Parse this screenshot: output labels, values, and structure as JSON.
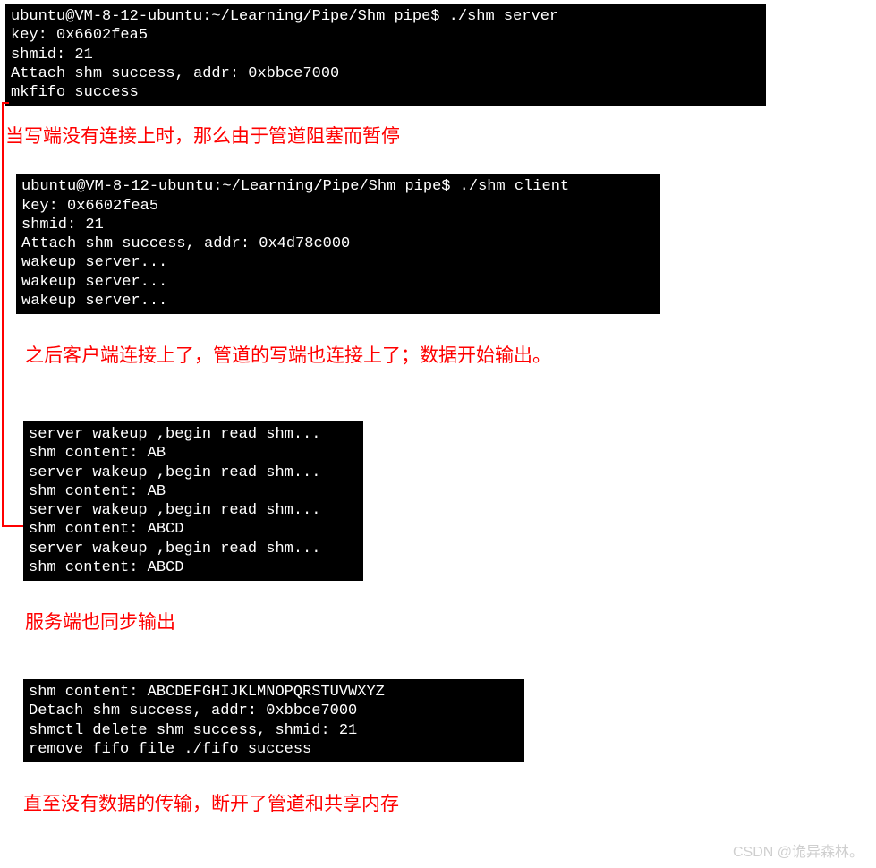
{
  "terminals": {
    "server_start": "ubuntu@VM-8-12-ubuntu:~/Learning/Pipe/Shm_pipe$ ./shm_server\nkey: 0x6602fea5\nshmid: 21\nAttach shm success, addr: 0xbbce7000\nmkfifo success",
    "client_start": "ubuntu@VM-8-12-ubuntu:~/Learning/Pipe/Shm_pipe$ ./shm_client\nkey: 0x6602fea5\nshmid: 21\nAttach shm success, addr: 0x4d78c000\nwakeup server...\nwakeup server...\nwakeup server...",
    "server_read": "server wakeup ,begin read shm...\nshm content: AB\nserver wakeup ,begin read shm...\nshm content: AB\nserver wakeup ,begin read shm...\nshm content: ABCD\nserver wakeup ,begin read shm...\nshm content: ABCD",
    "server_end": "shm content: ABCDEFGHIJKLMNOPQRSTUVWXYZ\nDetach shm success, addr: 0xbbce7000\nshmctl delete shm success, shmid: 21\nremove fifo file ./fifo success"
  },
  "annotations": {
    "a1": "当写端没有连接上时，那么由于管道阻塞而暂停",
    "a2": "之后客户端连接上了，管道的写端也连接上了；数据开始输出。",
    "a3": "服务端也同步输出",
    "a4": "直至没有数据的传输，断开了管道和共享内存"
  },
  "watermark": "CSDN @诡异森林。"
}
